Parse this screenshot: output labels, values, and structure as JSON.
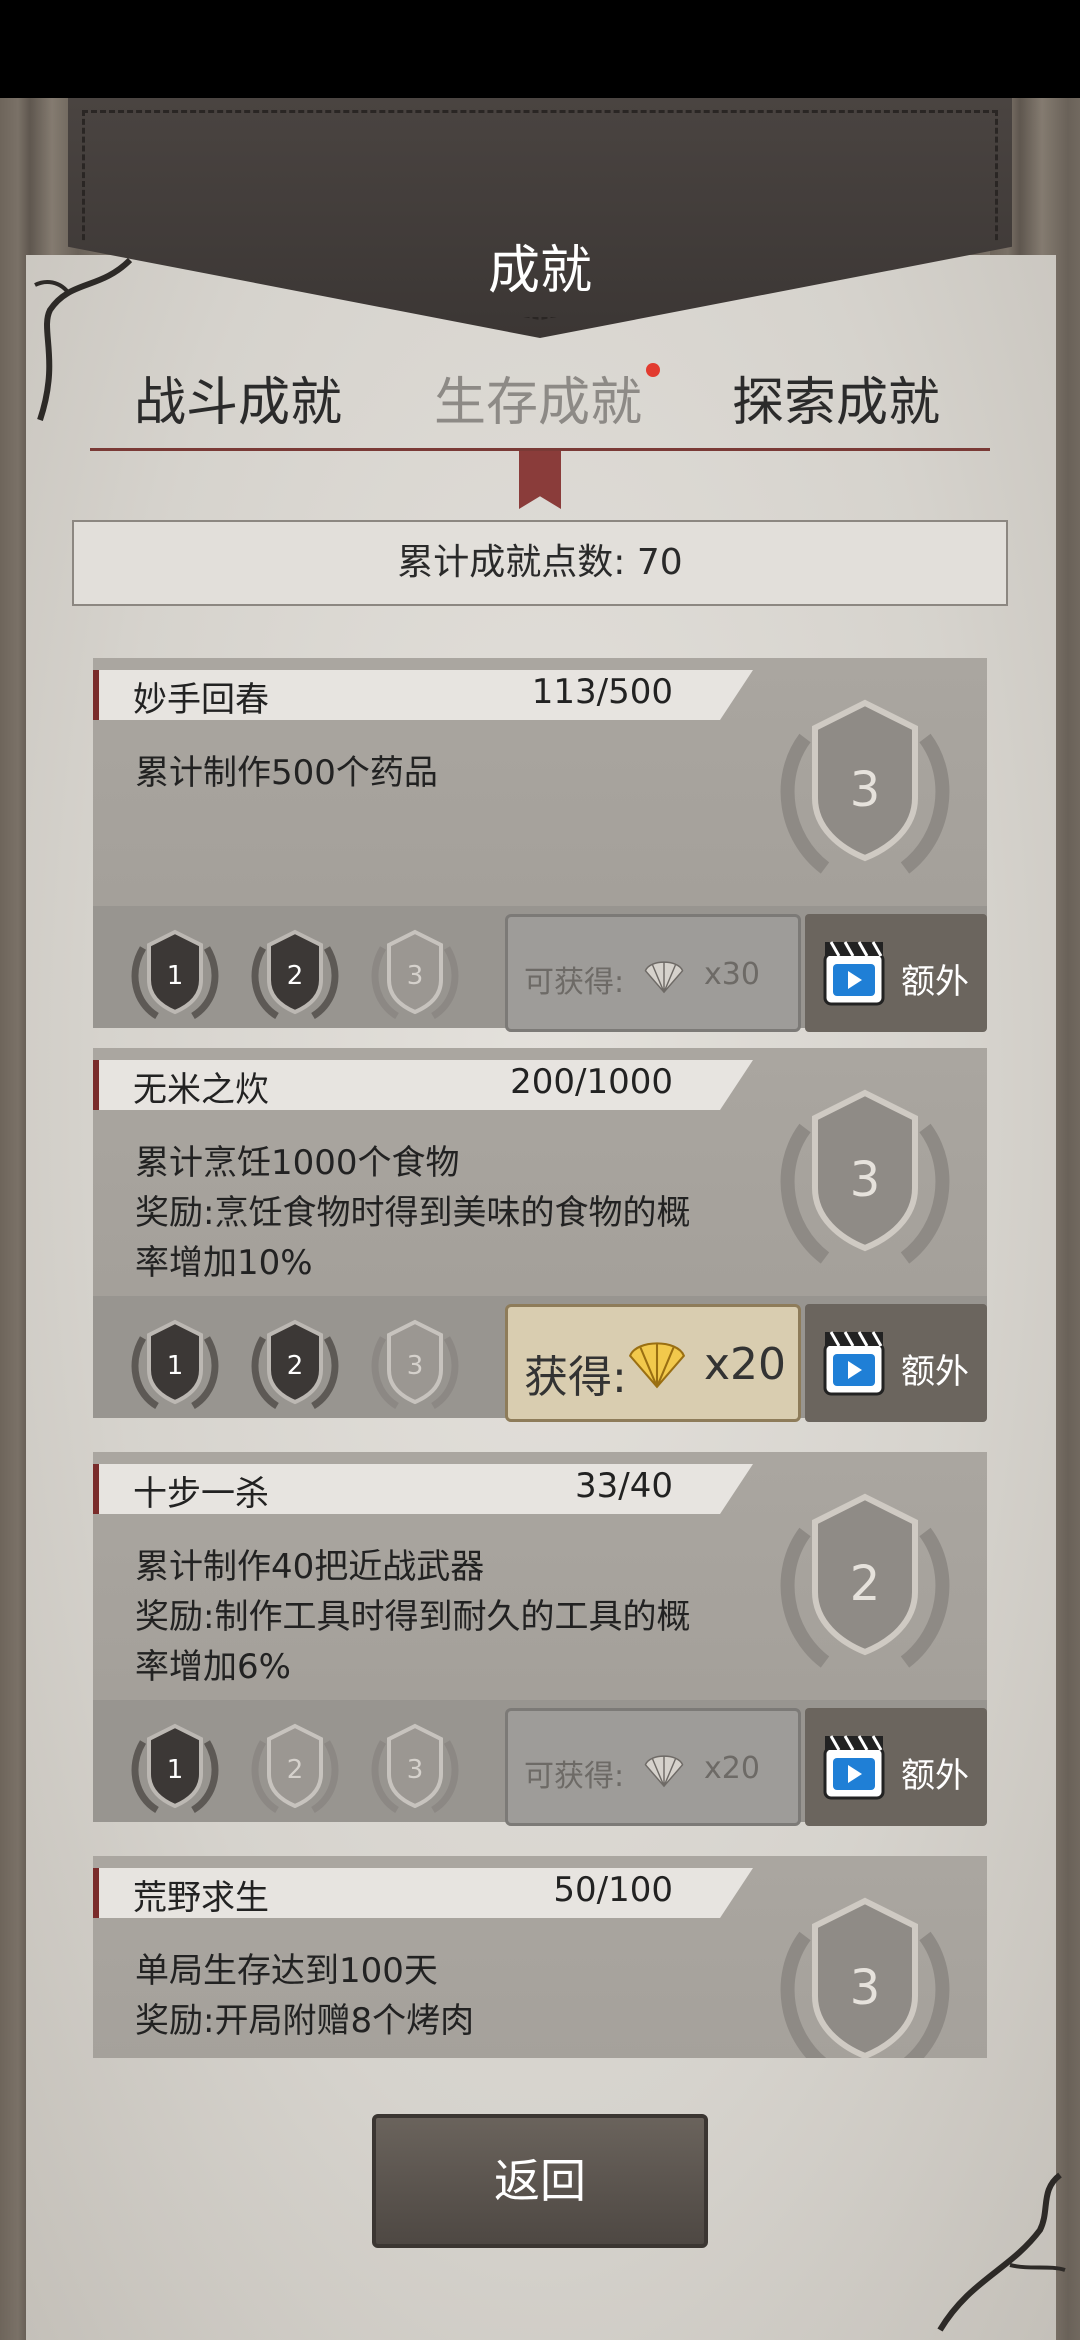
{
  "header": {
    "title": "成就"
  },
  "tabs": [
    {
      "label": "战斗成就",
      "active": false
    },
    {
      "label": "生存成就",
      "active": true,
      "has_notification": true
    },
    {
      "label": "探索成就",
      "active": false
    }
  ],
  "points": {
    "text": "累计成就点数: 70"
  },
  "achievements": [
    {
      "name": "妙手回春",
      "progress": "113/500",
      "desc": [
        "累计制作500个药品"
      ],
      "badge_level": "3",
      "medals": [
        {
          "label": "1",
          "earned": true
        },
        {
          "label": "2",
          "earned": true
        },
        {
          "label": "3",
          "earned": false
        }
      ],
      "reward": {
        "label": "可获得:",
        "qty": "x30",
        "claimable": false
      },
      "extra_label": "额外"
    },
    {
      "name": "无米之炊",
      "progress": "200/1000",
      "desc": [
        "累计烹饪1000个食物",
        "奖励:烹饪食物时得到美味的食物的概",
        "率增加10%"
      ],
      "badge_level": "3",
      "medals": [
        {
          "label": "1",
          "earned": true
        },
        {
          "label": "2",
          "earned": true
        },
        {
          "label": "3",
          "earned": false
        }
      ],
      "reward": {
        "label": "获得:",
        "qty": "x20",
        "claimable": true
      },
      "extra_label": "额外"
    },
    {
      "name": "十步一杀",
      "progress": "33/40",
      "desc": [
        "累计制作40把近战武器",
        "奖励:制作工具时得到耐久的工具的概",
        "率增加6%"
      ],
      "badge_level": "2",
      "medals": [
        {
          "label": "1",
          "earned": true
        },
        {
          "label": "2",
          "earned": false
        },
        {
          "label": "3",
          "earned": false
        }
      ],
      "reward": {
        "label": "可获得:",
        "qty": "x20",
        "claimable": false
      },
      "extra_label": "额外"
    },
    {
      "name": "荒野求生",
      "progress": "50/100",
      "desc": [
        "单局生存达到100天",
        "奖励:开局附赠8个烤肉"
      ],
      "badge_level": "3",
      "medals": [],
      "reward": null,
      "extra_label": ""
    }
  ],
  "footer": {
    "back_label": "返回"
  },
  "colors": {
    "accent_red": "#7a2c2b",
    "notification_dot": "#e23b2f",
    "gold_reward_bg": "#d9cdb0"
  }
}
